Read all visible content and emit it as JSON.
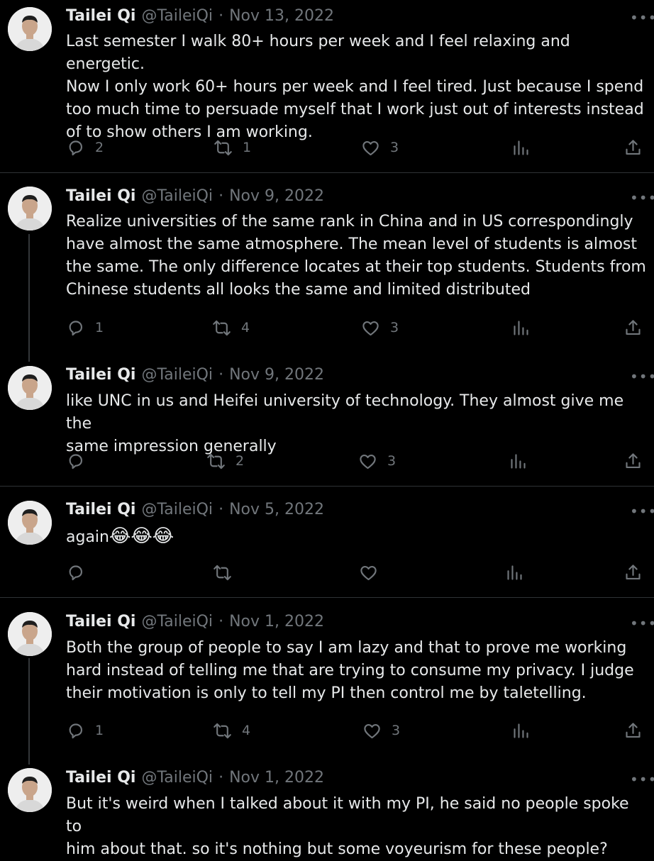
{
  "tweets": [
    {
      "name": "Tailei Qi",
      "handle": "@TaileiQi",
      "date": "Nov 13, 2022",
      "text": "Last semester I walk 80+ hours per week and I feel relaxing and energetic.\nNow I only work 60+ hours per week and I feel tired. Just because I spend\ntoo much time to persuade myself that I work just out of interests instead\nof to show others I am working.",
      "replies": "2",
      "retweets": "1",
      "likes": "3",
      "views": ""
    },
    {
      "name": "Tailei Qi",
      "handle": "@TaileiQi",
      "date": "Nov 9, 2022",
      "text": "Realize universities of the same rank in China and in US correspondingly\nhave almost the same atmosphere. The mean level of students is almost\nthe same. The only difference locates at their top students. Students from\nChinese students all looks the same and limited distributed",
      "replies": "1",
      "retweets": "4",
      "likes": "3",
      "views": ""
    },
    {
      "name": "Tailei Qi",
      "handle": "@TaileiQi",
      "date": "Nov 9, 2022",
      "text": "like UNC in us and Heifei university of technology. They almost give me the\nsame impression generally",
      "replies": "",
      "retweets": "2",
      "likes": "3",
      "views": ""
    },
    {
      "name": "Tailei Qi",
      "handle": "@TaileiQi",
      "date": "Nov 5, 2022",
      "text": "again",
      "emojis": "😂😂😂",
      "replies": "",
      "retweets": "",
      "likes": "",
      "views": ""
    },
    {
      "name": "Tailei Qi",
      "handle": "@TaileiQi",
      "date": "Nov 1, 2022",
      "text": "Both the group of people to say I am lazy and that to prove me working\nhard instead of telling me that are trying to consume my privacy. I judge\ntheir motivation is only to tell my PI then control me by taletelling.",
      "replies": "1",
      "retweets": "4",
      "likes": "3",
      "views": ""
    },
    {
      "name": "Tailei Qi",
      "handle": "@TaileiQi",
      "date": "Nov 1, 2022",
      "text": "But it's weird when I talked about it with my PI, he said no people spoke to\nhim about that. so it's nothing but some voyeurism for these people?",
      "replies": "",
      "retweets": "",
      "likes": "",
      "views": ""
    }
  ],
  "date_separator": "·",
  "more_glyph": "•••",
  "icons": {
    "reply": "speech-bubble-icon",
    "retweet": "retweet-arrows-icon",
    "like": "heart-icon",
    "views": "bar-chart-icon",
    "share": "share-upload-icon"
  },
  "colors": {
    "background": "#000000",
    "text": "#e7e9ea",
    "muted": "#71767b",
    "divider": "#2f3336"
  }
}
